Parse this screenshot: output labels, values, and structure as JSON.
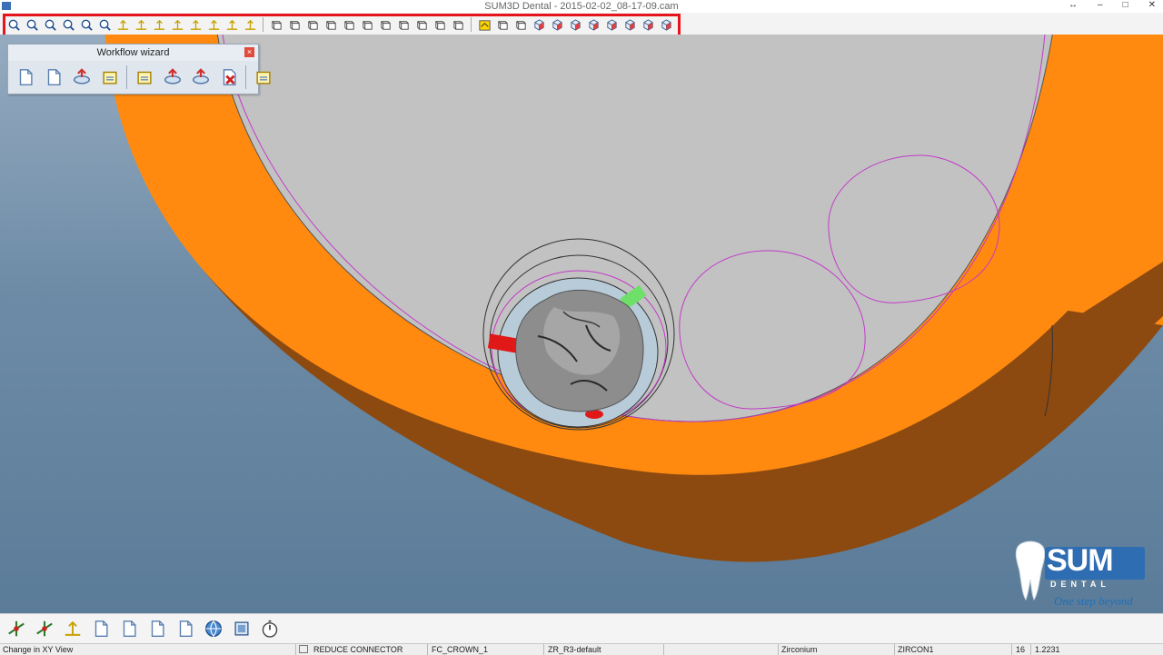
{
  "window": {
    "title": "SUM3D Dental  -  2015-02-02_08-17-09.cam"
  },
  "toolbar": {
    "group1_icons": [
      "zoom-window-icon",
      "zoom-out-icon",
      "zoom-previous-icon",
      "zoom-realtime-icon",
      "zoom-fit-icon",
      "pan-icon",
      "dimension-icon",
      "dimension-horizontal-icon",
      "measure-angle-icon",
      "move-up-icon",
      "move-right-icon",
      "axis-z-icon",
      "axis-y-icon",
      "clip-icon"
    ],
    "group2_icons": [
      "view-front-icon",
      "view-back-icon",
      "view-left-icon",
      "view-right-icon",
      "view-top-icon",
      "view-bottom-icon",
      "view-spline-icon",
      "view-section-icon",
      "view-section-2-icon",
      "view-wire-icon",
      "view-shade-icon"
    ],
    "group3_icons": [
      "view-xy-icon",
      "view-xz-icon",
      "view-yz-icon",
      "view-iso1-icon",
      "view-iso2-icon",
      "view-iso3-icon",
      "view-iso4-icon",
      "view-cube1-icon",
      "view-cube2-icon",
      "view-cube3-icon",
      "view-cube4-icon"
    ]
  },
  "wizard": {
    "title": "Workflow wizard",
    "icons": [
      "new-file-icon",
      "open-file-icon",
      "export-icon",
      "align-icon",
      "parameters-icon",
      "rotate-part-icon",
      "calculate-icon",
      "delete-icon",
      "tool-holder-icon"
    ]
  },
  "bottom_icons": [
    "gizmo-icon",
    "machining-icon",
    "move-axis-icon",
    "job-icon",
    "job-edit-icon",
    "info-doc-icon",
    "settings-doc-icon",
    "globe-icon",
    "report-icon",
    "stopwatch-icon"
  ],
  "logo": {
    "brand": "SUM",
    "sub": "DENTAL",
    "slogan": "One step beyond"
  },
  "status": {
    "message": "Change in XY View",
    "operation": "REDUCE CONNECTOR",
    "part": "FC_CROWN_1",
    "strategy": "ZR_R3-default",
    "material": "Zirconium",
    "blank": "ZIRCON1",
    "value1": "16",
    "value2": "1.2231"
  },
  "colors": {
    "accent_red": "#e8141c",
    "disk_orange": "#ff8a0f",
    "disk_brown": "#8c4a10",
    "blank_grey": "#c2c2c2",
    "toolpath_magenta": "#c23bc8"
  }
}
